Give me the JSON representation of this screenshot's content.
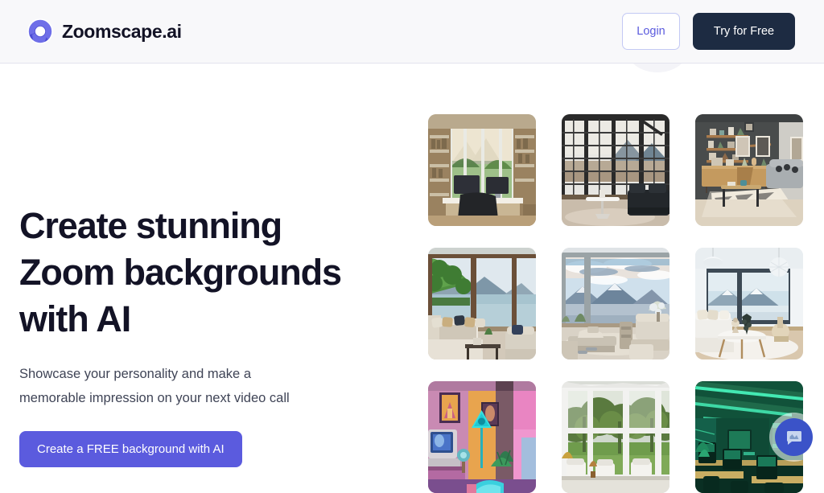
{
  "brand": {
    "name": "Zoomscape.ai",
    "logo_icon": "camera-aperture-icon",
    "accent_color": "#5B5BDE"
  },
  "header": {
    "background_color": "#F8F8FA",
    "border_color": "#E3E3EE",
    "login_label": "Login",
    "try_free_label": "Try for Free",
    "try_free_bg": "#1D2B42",
    "login_text_color": "#5B5BDE",
    "login_border_color": "#C3C9F4"
  },
  "hero": {
    "headline": "Create stunning\nZoom backgrounds\nwith AI",
    "headline_color": "#131326",
    "subheadline": "Showcase your personality and make a\nmemorable impression on your next video call",
    "subheadline_color": "#3F4456",
    "cta_label": "Create a FREE background with AI",
    "cta_bg": "#5B5BDE",
    "cta_text_color": "#FFFFFF"
  },
  "gallery": {
    "columns": 3,
    "rows": 3,
    "items": [
      {
        "id": "thumb-1",
        "name": "home-office-mountain-view",
        "alt": "Home office with large windows, dual monitors, bookshelves and a mountain jungle view"
      },
      {
        "id": "thumb-2",
        "name": "industrial-loft-grid-windows",
        "alt": "Industrial loft with black grid windows, dark sofa, white round table and mountains"
      },
      {
        "id": "thumb-3",
        "name": "dark-wall-living-room",
        "alt": "Dark grey living room with wood shelves, framed art, sideboard and zigzag rug"
      },
      {
        "id": "thumb-4",
        "name": "lakeside-lounge",
        "alt": "Lakeside lounge with sectional sofa, cushions and a green lake and mountain view"
      },
      {
        "id": "thumb-5",
        "name": "panoramic-mountain-terrace",
        "alt": "Panoramic mountain terrace with dramatic clouds, sofa and coffee table"
      },
      {
        "id": "thumb-6",
        "name": "bright-winter-room",
        "alt": "Bright winter room with white sofa, pendant lamps, round table and snowy mountain"
      },
      {
        "id": "thumb-7",
        "name": "retro-synthwave-room",
        "alt": "Retro vaporwave room with pink and orange walls, CRT monitor and cyan triangle lamp"
      },
      {
        "id": "thumb-8",
        "name": "glass-conservatory",
        "alt": "White framed glass conservatory sunroom looking out to green trees"
      },
      {
        "id": "thumb-9",
        "name": "neon-green-office",
        "alt": "Green neon strip lit office with desks, monitors and chairs"
      }
    ]
  },
  "chat_widget": {
    "icon": "chat-bubble-icon",
    "background_color": "#3B53C8",
    "label": "Open chat"
  }
}
